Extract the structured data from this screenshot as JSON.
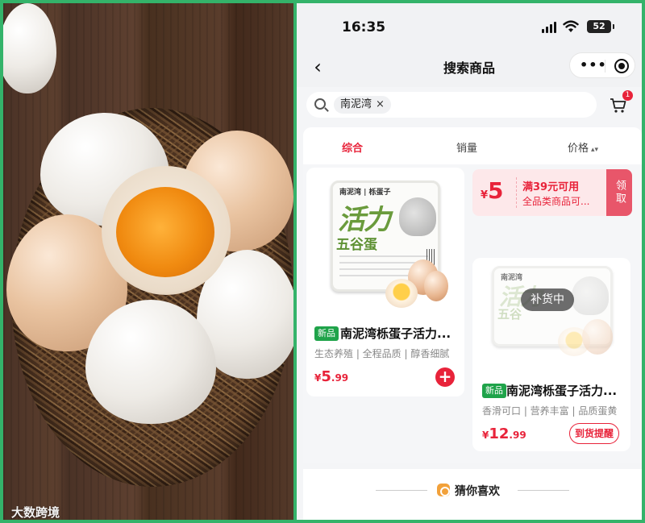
{
  "watermark": "大数跨境",
  "status": {
    "time": "16:35",
    "battery": "52"
  },
  "nav": {
    "title": "搜索商品",
    "back": "‹"
  },
  "search": {
    "chip": "南泥湾",
    "chip_clear": "×",
    "cart_badge": "1"
  },
  "sort": {
    "tabs": [
      "综合",
      "销量",
      "价格"
    ],
    "price_arrow": "▴▾"
  },
  "coupon": {
    "currency": "¥",
    "amount": "5",
    "line1": "满39元可用",
    "line2": "全品类商品可...",
    "claim": "领取"
  },
  "products": [
    {
      "tag": "新品",
      "title": "南泥湾栎蛋子活力...",
      "tags": "生态养殖 | 全程品质 | 醇香细腻",
      "price_currency": "¥",
      "price_int": "5",
      "price_dec": ".99",
      "pack_brand": "南泥湾 | 栎蛋子",
      "pack_name": "活力",
      "pack_sub": "五谷蛋"
    },
    {
      "tag": "新品",
      "title": "南泥湾栎蛋子活力...",
      "tags": "香滑可口 | 营养丰富 | 品质蛋黄",
      "price_currency": "¥",
      "price_int": "12",
      "price_dec": ".99",
      "oos": "补货中",
      "remind": "到货提醒",
      "pack_brand": "南泥湾",
      "pack_name": "活力",
      "pack_sub": "五谷"
    }
  ],
  "guess": {
    "label": "猜你喜欢"
  },
  "colors": {
    "accent": "#e8233a",
    "new_tag": "#1fa34a",
    "frame": "#34b36a"
  }
}
